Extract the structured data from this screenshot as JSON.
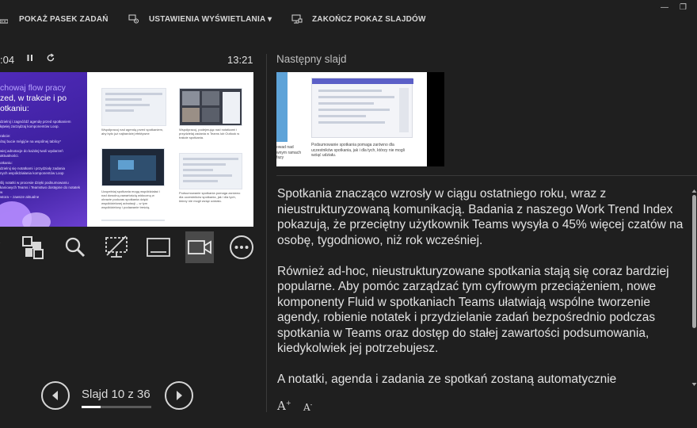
{
  "toolbar": {
    "taskbar_label": "POKAŻ PASEK ZADAŃ",
    "display_settings_label": "USTAWIENIA WYŚWIETLANIA ▾",
    "end_show_label": "ZAKOŃCZ POKAZ SLAJDÓW",
    "minimize": "—",
    "restore": "❐"
  },
  "presenter": {
    "elapsed": ":04",
    "clock": "13:21"
  },
  "current_slide": {
    "title_line1": "chowaj flow pracy",
    "title_line2": "zed, w trakcie i po",
    "title_line3": "otkaniu:",
    "bullets": [
      "dzielnij i zagnóźdź agendę przed spotkaniem",
      "łątwiej zarządzaj komponentów Loop.",
      "rakcie:",
      "ótuj bucie mégijóe na wspólnej tablicy*",
      "wiej adnotacje do każdej twoli wydarzeń",
      "aktualności.",
      "otkaniu:",
      "dzielnij się notatkami i przydziały zadania",
      "nych współdziałania komponentów Loop",
      "ślij notatki w procesie dzięki podsumowaniu",
      "kaniowych Teams i Teamstwo dostępne do notatek w",
      "wtora – zawsze aktualne"
    ],
    "captions": [
      "Współpracuj nad agendą przed spotkaniem, aby było już najbardziej efektywne",
      "Współpracuj, podejmując nad notatkami i przydzielaj zadania w Teams lub Outlook w trakcie spotkania.",
      "Uzupełniaj spotkania mogą współdziałać i nad dowolną zawartością widoczną w obrazie podczas spotkania dzięki współdzielonej adnotacji – w tym współdzielony i podawanie treścią.",
      "Podsumowanie spotkania pomaga zarówno dla uczestników spotkania, jak i dla tych, którzy nie mogli wziąć udziału."
    ]
  },
  "navigation": {
    "slide_counter": "Slajd 10 z 36",
    "current": 10,
    "total": 36
  },
  "next_slide": {
    "label": "Następny slajd",
    "left_caption": "owad nad wnym ramach fazy",
    "caption": "Podsumowanie spotkania pomaga zarówno dla uczestników spotkania, jak i dla tych, którzy nie mogli wziąć udziału."
  },
  "notes": {
    "paragraphs": [
      "Spotkania znacząco wzrosły w ciągu ostatniego roku, wraz z nieustrukturyzowaną komunikacją. Badania z naszego Work Trend Index pokazują, że przeciętny użytkownik Teams wysyła o 45% więcej czatów na osobę, tygodniowo, niż rok wcześniej.",
      "Również ad-hoc, nieustrukturyzowane spotkania stają się coraz bardziej popularne. Aby pomóc zarządzać tym cyfrowym przeciążeniem, nowe komponenty Fluid w spotkaniach Teams ułatwiają wspólne tworzenie agendy, robienie notatek i przydzielanie zadań bezpośrednio podczas spotkania w Teams oraz dostęp do stałej zawartości podsumowania, kiedykolwiek jej potrzebujesz.",
      "A notatki, agenda i zadania ze spotkań zostaną automatycznie"
    ],
    "scroll_fraction": 0.1
  },
  "font_controls": {
    "increase": "A",
    "decrease": "A"
  }
}
